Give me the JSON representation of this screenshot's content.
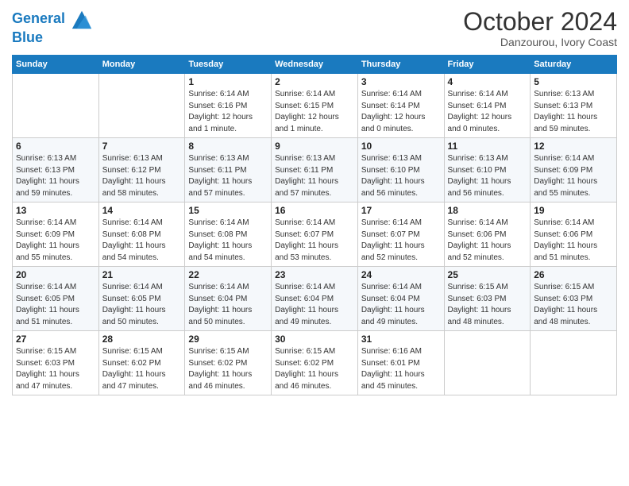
{
  "logo": {
    "line1": "General",
    "line2": "Blue"
  },
  "title": "October 2024",
  "location": "Danzourou, Ivory Coast",
  "days_of_week": [
    "Sunday",
    "Monday",
    "Tuesday",
    "Wednesday",
    "Thursday",
    "Friday",
    "Saturday"
  ],
  "weeks": [
    [
      {
        "day": "",
        "info": ""
      },
      {
        "day": "",
        "info": ""
      },
      {
        "day": "1",
        "info": "Sunrise: 6:14 AM\nSunset: 6:16 PM\nDaylight: 12 hours\nand 1 minute."
      },
      {
        "day": "2",
        "info": "Sunrise: 6:14 AM\nSunset: 6:15 PM\nDaylight: 12 hours\nand 1 minute."
      },
      {
        "day": "3",
        "info": "Sunrise: 6:14 AM\nSunset: 6:14 PM\nDaylight: 12 hours\nand 0 minutes."
      },
      {
        "day": "4",
        "info": "Sunrise: 6:14 AM\nSunset: 6:14 PM\nDaylight: 12 hours\nand 0 minutes."
      },
      {
        "day": "5",
        "info": "Sunrise: 6:13 AM\nSunset: 6:13 PM\nDaylight: 11 hours\nand 59 minutes."
      }
    ],
    [
      {
        "day": "6",
        "info": "Sunrise: 6:13 AM\nSunset: 6:13 PM\nDaylight: 11 hours\nand 59 minutes."
      },
      {
        "day": "7",
        "info": "Sunrise: 6:13 AM\nSunset: 6:12 PM\nDaylight: 11 hours\nand 58 minutes."
      },
      {
        "day": "8",
        "info": "Sunrise: 6:13 AM\nSunset: 6:11 PM\nDaylight: 11 hours\nand 57 minutes."
      },
      {
        "day": "9",
        "info": "Sunrise: 6:13 AM\nSunset: 6:11 PM\nDaylight: 11 hours\nand 57 minutes."
      },
      {
        "day": "10",
        "info": "Sunrise: 6:13 AM\nSunset: 6:10 PM\nDaylight: 11 hours\nand 56 minutes."
      },
      {
        "day": "11",
        "info": "Sunrise: 6:13 AM\nSunset: 6:10 PM\nDaylight: 11 hours\nand 56 minutes."
      },
      {
        "day": "12",
        "info": "Sunrise: 6:14 AM\nSunset: 6:09 PM\nDaylight: 11 hours\nand 55 minutes."
      }
    ],
    [
      {
        "day": "13",
        "info": "Sunrise: 6:14 AM\nSunset: 6:09 PM\nDaylight: 11 hours\nand 55 minutes."
      },
      {
        "day": "14",
        "info": "Sunrise: 6:14 AM\nSunset: 6:08 PM\nDaylight: 11 hours\nand 54 minutes."
      },
      {
        "day": "15",
        "info": "Sunrise: 6:14 AM\nSunset: 6:08 PM\nDaylight: 11 hours\nand 54 minutes."
      },
      {
        "day": "16",
        "info": "Sunrise: 6:14 AM\nSunset: 6:07 PM\nDaylight: 11 hours\nand 53 minutes."
      },
      {
        "day": "17",
        "info": "Sunrise: 6:14 AM\nSunset: 6:07 PM\nDaylight: 11 hours\nand 52 minutes."
      },
      {
        "day": "18",
        "info": "Sunrise: 6:14 AM\nSunset: 6:06 PM\nDaylight: 11 hours\nand 52 minutes."
      },
      {
        "day": "19",
        "info": "Sunrise: 6:14 AM\nSunset: 6:06 PM\nDaylight: 11 hours\nand 51 minutes."
      }
    ],
    [
      {
        "day": "20",
        "info": "Sunrise: 6:14 AM\nSunset: 6:05 PM\nDaylight: 11 hours\nand 51 minutes."
      },
      {
        "day": "21",
        "info": "Sunrise: 6:14 AM\nSunset: 6:05 PM\nDaylight: 11 hours\nand 50 minutes."
      },
      {
        "day": "22",
        "info": "Sunrise: 6:14 AM\nSunset: 6:04 PM\nDaylight: 11 hours\nand 50 minutes."
      },
      {
        "day": "23",
        "info": "Sunrise: 6:14 AM\nSunset: 6:04 PM\nDaylight: 11 hours\nand 49 minutes."
      },
      {
        "day": "24",
        "info": "Sunrise: 6:14 AM\nSunset: 6:04 PM\nDaylight: 11 hours\nand 49 minutes."
      },
      {
        "day": "25",
        "info": "Sunrise: 6:15 AM\nSunset: 6:03 PM\nDaylight: 11 hours\nand 48 minutes."
      },
      {
        "day": "26",
        "info": "Sunrise: 6:15 AM\nSunset: 6:03 PM\nDaylight: 11 hours\nand 48 minutes."
      }
    ],
    [
      {
        "day": "27",
        "info": "Sunrise: 6:15 AM\nSunset: 6:03 PM\nDaylight: 11 hours\nand 47 minutes."
      },
      {
        "day": "28",
        "info": "Sunrise: 6:15 AM\nSunset: 6:02 PM\nDaylight: 11 hours\nand 47 minutes."
      },
      {
        "day": "29",
        "info": "Sunrise: 6:15 AM\nSunset: 6:02 PM\nDaylight: 11 hours\nand 46 minutes."
      },
      {
        "day": "30",
        "info": "Sunrise: 6:15 AM\nSunset: 6:02 PM\nDaylight: 11 hours\nand 46 minutes."
      },
      {
        "day": "31",
        "info": "Sunrise: 6:16 AM\nSunset: 6:01 PM\nDaylight: 11 hours\nand 45 minutes."
      },
      {
        "day": "",
        "info": ""
      },
      {
        "day": "",
        "info": ""
      }
    ]
  ]
}
